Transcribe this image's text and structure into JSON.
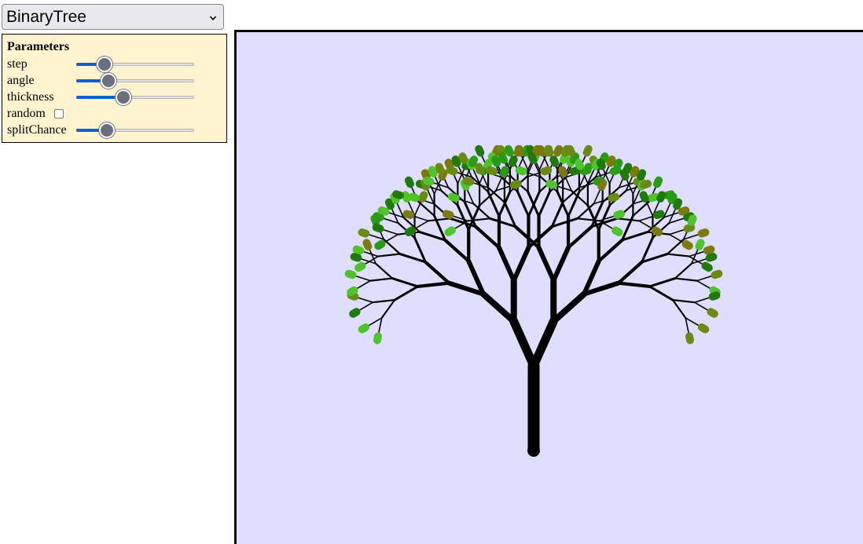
{
  "selector": {
    "value": "BinaryTree"
  },
  "panel": {
    "title": "Parameters",
    "params": [
      {
        "label": "step",
        "type": "slider",
        "fraction": 0.24
      },
      {
        "label": "angle",
        "type": "slider",
        "fraction": 0.27
      },
      {
        "label": "thickness",
        "type": "slider",
        "fraction": 0.4
      },
      {
        "label": "random",
        "type": "checkbox",
        "checked": false
      },
      {
        "label": "splitChance",
        "type": "slider",
        "fraction": 0.26
      }
    ]
  },
  "colors": {
    "canvas_bg": "#dfdefe",
    "branch": "#000000",
    "leaves": [
      "#1f7a0a",
      "#6b8a12",
      "#4ec32a",
      "#2a9b16",
      "#7a7a10"
    ]
  },
  "tree": {
    "type": "BinaryTree",
    "depth": 7
  }
}
